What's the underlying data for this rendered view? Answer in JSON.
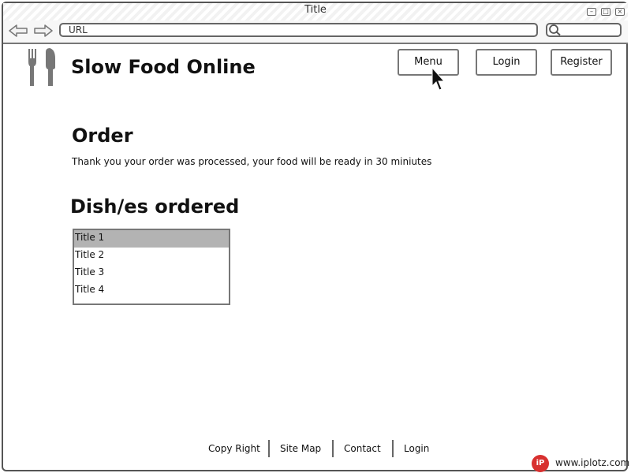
{
  "window": {
    "title": "Title"
  },
  "toolbar": {
    "url": "URL",
    "back_icon": "back-arrow-icon",
    "forward_icon": "forward-arrow-icon",
    "search_icon": "search-icon"
  },
  "header": {
    "site_title": "Slow Food Online",
    "logo_icon": "fork-knife-icon",
    "nav": {
      "menu": "Menu",
      "login": "Login",
      "register": "Register"
    }
  },
  "main": {
    "order_heading": "Order",
    "order_message": "Thank you your order was processed, your food will be ready in 30 miniutes",
    "dishes_heading": "Dish/es ordered",
    "dishes": [
      "Title 1",
      "Title 2",
      "Title 3",
      "Title 4"
    ],
    "selected_dish": "Title 1"
  },
  "footer": {
    "links": [
      "Copy Right",
      "Site Map",
      "Contact",
      "Login"
    ]
  },
  "watermark": {
    "logo_text": "iP",
    "text": "www.iplotz.com"
  },
  "colors": {
    "selected_row": "#b3b3b3",
    "border": "#777777",
    "watermark_brand": "#d8302f"
  }
}
